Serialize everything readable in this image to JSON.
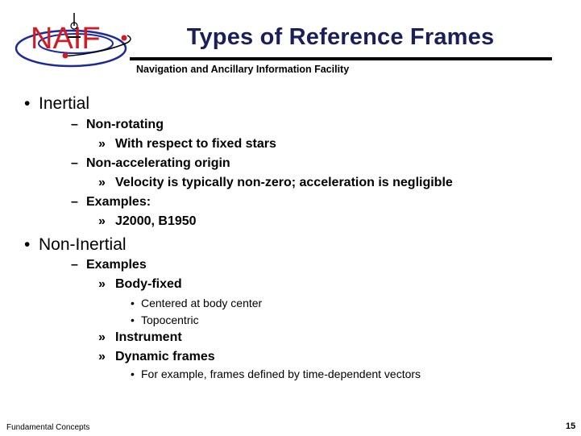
{
  "header": {
    "logo_text": "NAIF",
    "title": "Types of Reference Frames",
    "subtitle": "Navigation and Ancillary Information Facility"
  },
  "colors": {
    "title": "#1a1f5a",
    "logo_red": "#d01c24",
    "logo_orbit": "#1c2a9a"
  },
  "markers": {
    "level1": "•",
    "level2": "–",
    "level3": "»",
    "level4": "•"
  },
  "content": [
    {
      "level": 1,
      "text": "Inertial"
    },
    {
      "level": 2,
      "text": "Non-rotating"
    },
    {
      "level": 3,
      "text": "With respect to fixed stars"
    },
    {
      "level": 2,
      "text": "Non-accelerating origin"
    },
    {
      "level": 3,
      "text": "Velocity is typically non-zero; acceleration is negligible"
    },
    {
      "level": 2,
      "text": "Examples:"
    },
    {
      "level": 3,
      "text": "J2000, B1950"
    },
    {
      "level": 1,
      "text": "Non-Inertial"
    },
    {
      "level": 2,
      "text": "Examples"
    },
    {
      "level": 3,
      "text": "Body-fixed"
    },
    {
      "level": 4,
      "text": "Centered at body center"
    },
    {
      "level": 4,
      "text": "Topocentric"
    },
    {
      "level": 3,
      "text": "Instrument"
    },
    {
      "level": 3,
      "text": "Dynamic frames"
    },
    {
      "level": 4,
      "text": "For example, frames defined by time-dependent vectors"
    }
  ],
  "footer": {
    "section": "Fundamental Concepts",
    "page_number": "15"
  }
}
